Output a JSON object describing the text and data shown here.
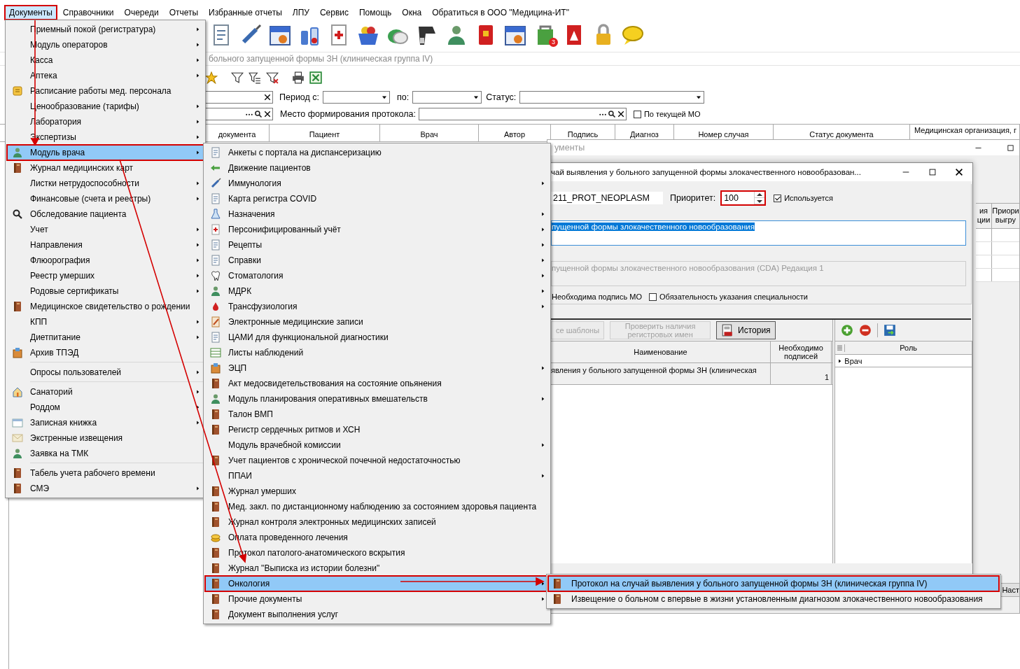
{
  "menubar": [
    {
      "label": "Документы",
      "selected": true,
      "annotated": true
    },
    {
      "label": "Справочники",
      "selected": false,
      "annotated": false
    },
    {
      "label": "Очереди",
      "selected": false,
      "annotated": false
    },
    {
      "label": "Отчеты",
      "selected": false,
      "annotated": false
    },
    {
      "label": "Избранные отчеты",
      "selected": false,
      "annotated": false
    },
    {
      "label": "ЛПУ",
      "selected": false,
      "annotated": false
    },
    {
      "label": "Сервис",
      "selected": false,
      "annotated": false
    },
    {
      "label": "Помощь",
      "selected": false,
      "annotated": false
    },
    {
      "label": "Окна",
      "selected": false,
      "annotated": false
    },
    {
      "label": "Обратиться в ООО \"Медицина-ИТ\"",
      "selected": false,
      "annotated": false
    }
  ],
  "toolbar_badge": "3",
  "breadcrumb": "больного запущенной формы ЗН (клиническая группа IV)",
  "filters": {
    "period_from_label": "Период с:",
    "period_to_label": "по:",
    "status_label": "Статус:",
    "place_label": "Место формирования протокола:",
    "current_mo": {
      "label": "По текущей МО",
      "checked": false
    }
  },
  "table": {
    "columns": [
      "документа",
      "Пациент",
      "Врач",
      "Автор",
      "Подпись",
      "Диагноз",
      "Номер случая",
      "Статус документа",
      "Медицинская организация, г"
    ]
  },
  "documents_window": {
    "title": "ументы",
    "columns": [
      "ия\nции",
      "Приори\nвыгру"
    ],
    "button": "Наст"
  },
  "dialog": {
    "title": "чай выявления у больного запущенной формы злокачественного новообразован...",
    "code": "211_PROT_NEOPLASM",
    "priority_label": "Приоритет:",
    "priority": "100",
    "priority_annotated": true,
    "used": {
      "label": "Используется",
      "checked": true
    },
    "name": "пущенной формы злокачественного новообразования",
    "name_selected": true,
    "template": "пущенной формы злокачественного новообразования (CDA) Редакция 1",
    "sign_mo_label": "Необходима подпись МО",
    "specialty": {
      "label": "Обязательность указания специальности",
      "checked": false
    },
    "buttons": [
      {
        "label": "се шаблоны",
        "disabled": true,
        "kind": "text"
      },
      {
        "label": "Проверить наличия\nрегистровых имен",
        "disabled": true,
        "kind": "text"
      },
      {
        "label": "История",
        "disabled": false,
        "kind": "history"
      }
    ],
    "signatures": {
      "columns": [
        "Наименование",
        "Необходимо\nподписей"
      ],
      "rows": [
        [
          "явления у больного запущенной формы ЗН (клиническая",
          "1"
        ]
      ]
    },
    "roles": {
      "column": "Роль",
      "rows": [
        {
          "label": "Врач",
          "selected": true
        }
      ]
    }
  },
  "main_menu": [
    {
      "kind": "item",
      "label": "Приемный покой (регистратура)",
      "submenu": true,
      "selected": false,
      "annotated": false
    },
    {
      "kind": "item",
      "label": "Модуль операторов",
      "submenu": true,
      "selected": false,
      "annotated": false
    },
    {
      "kind": "item",
      "label": "Касса",
      "submenu": true,
      "selected": false,
      "annotated": false
    },
    {
      "kind": "item",
      "label": "Аптека",
      "submenu": true,
      "selected": false,
      "annotated": false
    },
    {
      "kind": "item",
      "label": "Расписание работы мед. персонала",
      "submenu": false,
      "selected": false,
      "annotated": false
    },
    {
      "kind": "item",
      "label": "Ценообразование (тарифы)",
      "submenu": true,
      "selected": false,
      "annotated": false
    },
    {
      "kind": "item",
      "label": "Лаборатория",
      "submenu": true,
      "selected": false,
      "annotated": false
    },
    {
      "kind": "item",
      "label": "Экспертизы",
      "submenu": true,
      "selected": false,
      "annotated": false
    },
    {
      "kind": "item",
      "label": "Модуль врача",
      "submenu": true,
      "selected": true,
      "annotated": true
    },
    {
      "kind": "item",
      "label": "Журнал медицинских карт",
      "submenu": false,
      "selected": false,
      "annotated": false
    },
    {
      "kind": "item",
      "label": "Листки нетрудоспособности",
      "submenu": true,
      "selected": false,
      "annotated": false
    },
    {
      "kind": "item",
      "label": "Финансовые (счета и реестры)",
      "submenu": true,
      "selected": false,
      "annotated": false
    },
    {
      "kind": "item",
      "label": "Обследование пациента",
      "submenu": false,
      "selected": false,
      "annotated": false
    },
    {
      "kind": "item",
      "label": "Учет",
      "submenu": true,
      "selected": false,
      "annotated": false
    },
    {
      "kind": "item",
      "label": "Направления",
      "submenu": true,
      "selected": false,
      "annotated": false
    },
    {
      "kind": "item",
      "label": "Флюорография",
      "submenu": true,
      "selected": false,
      "annotated": false
    },
    {
      "kind": "item",
      "label": "Реестр умерших",
      "submenu": true,
      "selected": false,
      "annotated": false
    },
    {
      "kind": "item",
      "label": "Родовые сертификаты",
      "submenu": true,
      "selected": false,
      "annotated": false
    },
    {
      "kind": "item",
      "label": "Медицинское свидетельство о рождении",
      "submenu": false,
      "selected": false,
      "annotated": false
    },
    {
      "kind": "item",
      "label": "КПП",
      "submenu": true,
      "selected": false,
      "annotated": false
    },
    {
      "kind": "item",
      "label": "Диетпитание",
      "submenu": true,
      "selected": false,
      "annotated": false
    },
    {
      "kind": "item",
      "label": "Архив ТПЭД",
      "submenu": false,
      "selected": false,
      "annotated": false
    },
    {
      "kind": "separator"
    },
    {
      "kind": "item",
      "label": "Опросы пользователей",
      "submenu": true,
      "selected": false,
      "annotated": false
    },
    {
      "kind": "separator"
    },
    {
      "kind": "item",
      "label": "Санаторий",
      "submenu": true,
      "selected": false,
      "annotated": false
    },
    {
      "kind": "item",
      "label": "Роддом",
      "submenu": true,
      "selected": false,
      "annotated": false
    },
    {
      "kind": "item",
      "label": "Записная книжка",
      "submenu": true,
      "selected": false,
      "annotated": false
    },
    {
      "kind": "item",
      "label": "Экстренные извещения",
      "submenu": false,
      "selected": false,
      "annotated": false
    },
    {
      "kind": "item",
      "label": "Заявка на ТМК",
      "submenu": false,
      "selected": false,
      "annotated": false
    },
    {
      "kind": "separator"
    },
    {
      "kind": "item",
      "label": "Табель учета рабочего времени",
      "submenu": false,
      "selected": false,
      "annotated": false
    },
    {
      "kind": "item",
      "label": "СМЭ",
      "submenu": true,
      "selected": false,
      "annotated": false
    }
  ],
  "doctor_menu": [
    {
      "kind": "item",
      "label": "Анкеты с портала на диспансеризацию",
      "submenu": false,
      "selected": false,
      "annotated": false
    },
    {
      "kind": "item",
      "label": "Движение пациентов",
      "submenu": false,
      "selected": false,
      "annotated": false
    },
    {
      "kind": "item",
      "label": "Иммунология",
      "submenu": true,
      "selected": false,
      "annotated": false
    },
    {
      "kind": "item",
      "label": "Карта регистра COVID",
      "submenu": false,
      "selected": false,
      "annotated": false
    },
    {
      "kind": "item",
      "label": "Назначения",
      "submenu": true,
      "selected": false,
      "annotated": false
    },
    {
      "kind": "item",
      "label": "Персонифицированный учёт",
      "submenu": true,
      "selected": false,
      "annotated": false
    },
    {
      "kind": "item",
      "label": "Рецепты",
      "submenu": true,
      "selected": false,
      "annotated": false
    },
    {
      "kind": "item",
      "label": "Справки",
      "submenu": true,
      "selected": false,
      "annotated": false
    },
    {
      "kind": "item",
      "label": "Стоматология",
      "submenu": true,
      "selected": false,
      "annotated": false
    },
    {
      "kind": "item",
      "label": "МДРК",
      "submenu": true,
      "selected": false,
      "annotated": false
    },
    {
      "kind": "item",
      "label": "Трансфузиология",
      "submenu": true,
      "selected": false,
      "annotated": false
    },
    {
      "kind": "item",
      "label": "Электронные медицинские записи",
      "submenu": false,
      "selected": false,
      "annotated": false
    },
    {
      "kind": "item",
      "label": "ЦАМИ для функциональной диагностики",
      "submenu": false,
      "selected": false,
      "annotated": false
    },
    {
      "kind": "item",
      "label": "Листы наблюдений",
      "submenu": false,
      "selected": false,
      "annotated": false
    },
    {
      "kind": "item",
      "label": "ЭЦП",
      "submenu": true,
      "selected": false,
      "annotated": false
    },
    {
      "kind": "item",
      "label": "Акт медосвидетельствования на состояние опьянения",
      "submenu": false,
      "selected": false,
      "annotated": false
    },
    {
      "kind": "item",
      "label": "Модуль планирования оперативных вмешательств",
      "submenu": true,
      "selected": false,
      "annotated": false
    },
    {
      "kind": "item",
      "label": "Талон ВМП",
      "submenu": false,
      "selected": false,
      "annotated": false
    },
    {
      "kind": "item",
      "label": "Регистр сердечных ритмов и ХСН",
      "submenu": false,
      "selected": false,
      "annotated": false
    },
    {
      "kind": "item",
      "label": "Модуль врачебной комиссии",
      "submenu": true,
      "selected": false,
      "annotated": false
    },
    {
      "kind": "item",
      "label": "Учет пациентов с хронической почечной недостаточностью",
      "submenu": false,
      "selected": false,
      "annotated": false
    },
    {
      "kind": "item",
      "label": "ППАИ",
      "submenu": true,
      "selected": false,
      "annotated": false
    },
    {
      "kind": "item",
      "label": "Журнал умерших",
      "submenu": false,
      "selected": false,
      "annotated": false
    },
    {
      "kind": "item",
      "label": "Мед. закл. по дистанционному наблюдению за состоянием здоровья пациента",
      "submenu": false,
      "selected": false,
      "annotated": false
    },
    {
      "kind": "item",
      "label": "Журнал контроля электронных медицинских записей",
      "submenu": false,
      "selected": false,
      "annotated": false
    },
    {
      "kind": "item",
      "label": "Оплата проведенного лечения",
      "submenu": false,
      "selected": false,
      "annotated": false
    },
    {
      "kind": "item",
      "label": "Протокол патолого-анатомического вскрытия",
      "submenu": false,
      "selected": false,
      "annotated": false
    },
    {
      "kind": "item",
      "label": "Журнал \"Выписка из истории болезни\"",
      "submenu": false,
      "selected": false,
      "annotated": false
    },
    {
      "kind": "item",
      "label": "Онкология",
      "submenu": true,
      "selected": true,
      "annotated": true
    },
    {
      "kind": "item",
      "label": "Прочие документы",
      "submenu": true,
      "selected": false,
      "annotated": false
    },
    {
      "kind": "item",
      "label": "Документ выполнения услуг",
      "submenu": false,
      "selected": false,
      "annotated": false
    }
  ],
  "oncology_menu": [
    {
      "kind": "item",
      "label": "Протокол на случай выявления у больного запущенной формы ЗН (клиническая группа IV)",
      "submenu": false,
      "selected": true,
      "annotated": true
    },
    {
      "kind": "item",
      "label": "Извещение о больном с впервые в жизни установленным диагнозом злокачественного новообразования",
      "submenu": false,
      "selected": false,
      "annotated": false
    }
  ]
}
